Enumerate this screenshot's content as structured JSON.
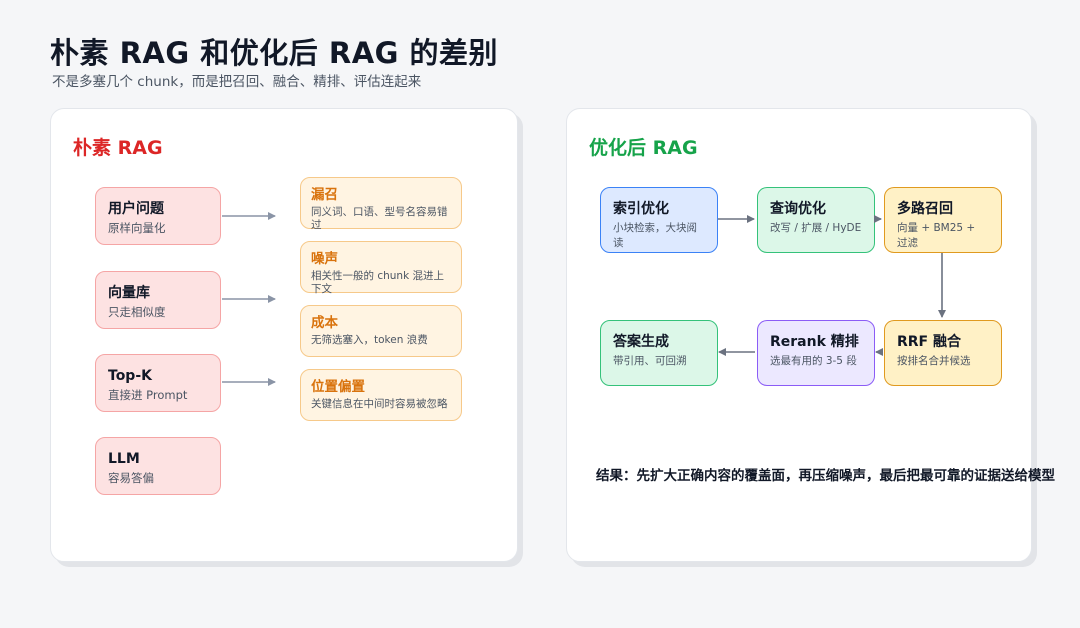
{
  "title": "朴素 RAG 和优化后 RAG 的差别",
  "subtitle": "不是多塞几个 chunk，而是把召回、融合、精排、评估连起来",
  "naive": {
    "title": "朴素 RAG",
    "steps": [
      {
        "title": "用户问题",
        "desc": "原样向量化"
      },
      {
        "title": "向量库",
        "desc": "只走相似度"
      },
      {
        "title": "Top-K",
        "desc": "直接进 Prompt"
      },
      {
        "title": "LLM",
        "desc": "容易答偏"
      }
    ],
    "problems": [
      {
        "title": "漏召",
        "desc": "同义词、口语、型号名容易错过"
      },
      {
        "title": "噪声",
        "desc": "相关性一般的 chunk 混进上下文"
      },
      {
        "title": "成本",
        "desc": "无筛选塞入，token 浪费"
      },
      {
        "title": "位置偏置",
        "desc": "关键信息在中间时容易被忽略"
      }
    ]
  },
  "optimized": {
    "title": "优化后 RAG",
    "steps": [
      {
        "title": "索引优化",
        "desc": "小块检索，大块阅读"
      },
      {
        "title": "查询优化",
        "desc": "改写 / 扩展 / HyDE"
      },
      {
        "title": "多路召回",
        "desc": "向量 + BM25 + 过滤"
      },
      {
        "title": "RRF 融合",
        "desc": "按排名合并候选"
      },
      {
        "title": "Rerank 精排",
        "desc": "选最有用的 3-5 段"
      },
      {
        "title": "答案生成",
        "desc": "带引用、可回溯"
      }
    ],
    "result": "结果：先扩大正确内容的覆盖面，再压缩噪声，最后把最可靠的证据送给模型"
  },
  "colors": {
    "naive_title": "#dc2626",
    "optimized_title": "#16a34a",
    "arrow": "#8a94a6"
  }
}
